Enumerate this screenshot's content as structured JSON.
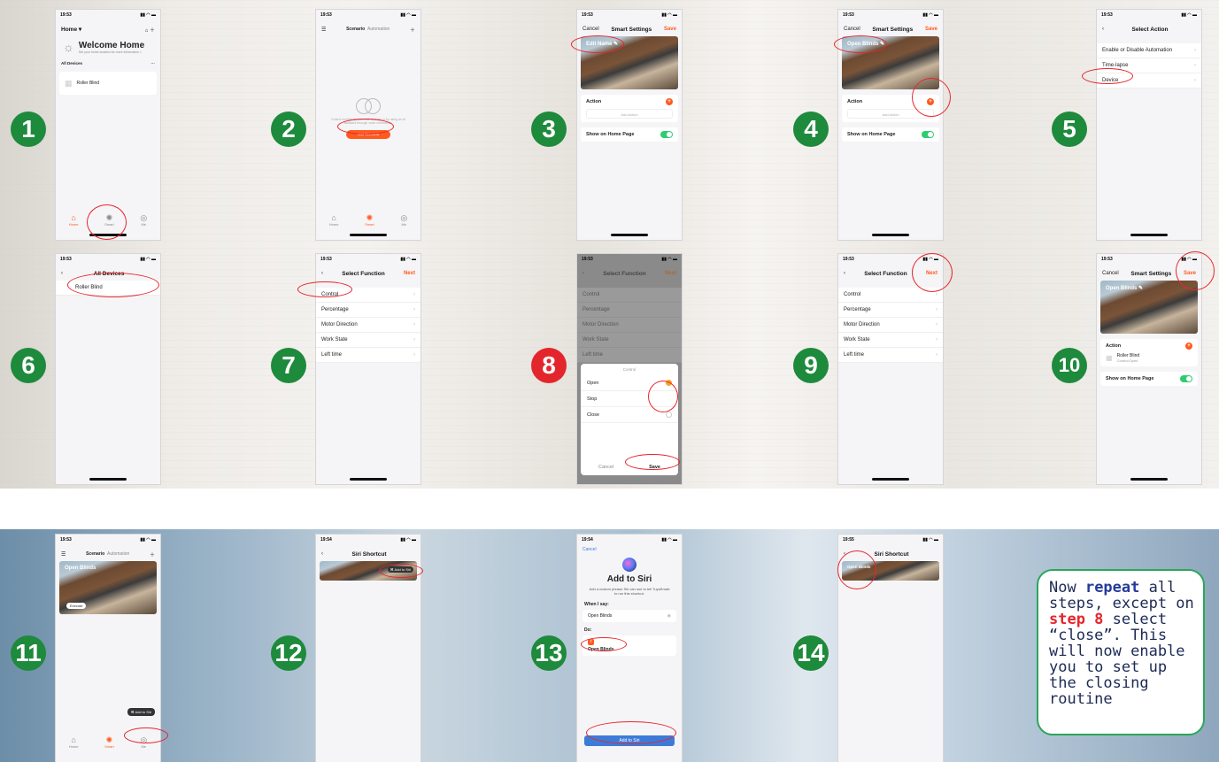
{
  "note": {
    "p1": "Now ",
    "repeat": "repeat",
    "p2": " all steps, except on ",
    "step8": "step 8",
    "p3": " select “close”. This will now enable you to set up the closing routine"
  },
  "numbers": [
    "1",
    "2",
    "3",
    "4",
    "5",
    "6",
    "7",
    "8",
    "9",
    "10",
    "11",
    "12",
    "13",
    "14"
  ],
  "s1": {
    "time": "19:53",
    "home": "Home",
    "welcome": "Welcome Home",
    "sub": "Set your home location for more information >",
    "all_devices": "All Devices",
    "device": "Roller Blind",
    "tabs": [
      "Home",
      "Smart",
      "Me"
    ]
  },
  "s2": {
    "time": "19:53",
    "tab_scenario": "Scenario",
    "tab_automation": "Automation",
    "empty": "Control multiple devices with one tap or by using an AI assistant through voice commands.",
    "add_btn": "Add Scenario"
  },
  "s3": {
    "time": "19:53",
    "cancel": "Cancel",
    "title": "Smart Settings",
    "save": "Save",
    "cover_title": "Edit Name",
    "action": "Action",
    "add_action": "Add Action",
    "show_home": "Show on Home Page"
  },
  "s4": {
    "time": "19:53",
    "cover_title": "Open Blinds"
  },
  "s5": {
    "time": "19:53",
    "title": "Select Action",
    "items": [
      "Enable or Disable Automation",
      "Time-lapse",
      "Device"
    ]
  },
  "s6": {
    "time": "19:53",
    "title": "All Devices",
    "device": "Roller Blind"
  },
  "s7": {
    "time": "19:53",
    "title": "Select Function",
    "next": "Next",
    "items": [
      "Control",
      "Percentage",
      "Motor Direction",
      "Work State",
      "Left time"
    ]
  },
  "s8": {
    "time": "19:53",
    "sheet_title": "Control",
    "options": [
      "Open",
      "Stop",
      "Close"
    ],
    "cancel": "Cancel",
    "save": "Save"
  },
  "s10": {
    "time": "19:53",
    "device": "Roller Blind",
    "device_sub": "Control:Open"
  },
  "s11": {
    "time": "19:53",
    "cover_title": "Open Blinds",
    "execute": "Execute",
    "add_siri": "Add to Siri"
  },
  "s12": {
    "time": "19:54",
    "title": "Siri Shortcut",
    "add_siri": "Add to Siri"
  },
  "s13": {
    "time": "19:54",
    "cancel": "Cancel",
    "title": "Add to Siri",
    "desc": "Add a custom phrase Siri can use to tell TuyaSmart to run this shortcut.",
    "when": "When I say:",
    "phrase": "Open Blinds",
    "do": "Do:",
    "shortcut": "Open Blinds",
    "add_btn": "Add to Siri"
  },
  "s14": {
    "time": "19:55",
    "title": "Siri Shortcut",
    "cover_title": "Open Blinds"
  },
  "colors": {
    "accent": "#ff5a1f",
    "step_green": "#1e8a3c",
    "step_red": "#e3262c",
    "circle": "#e8262c"
  }
}
